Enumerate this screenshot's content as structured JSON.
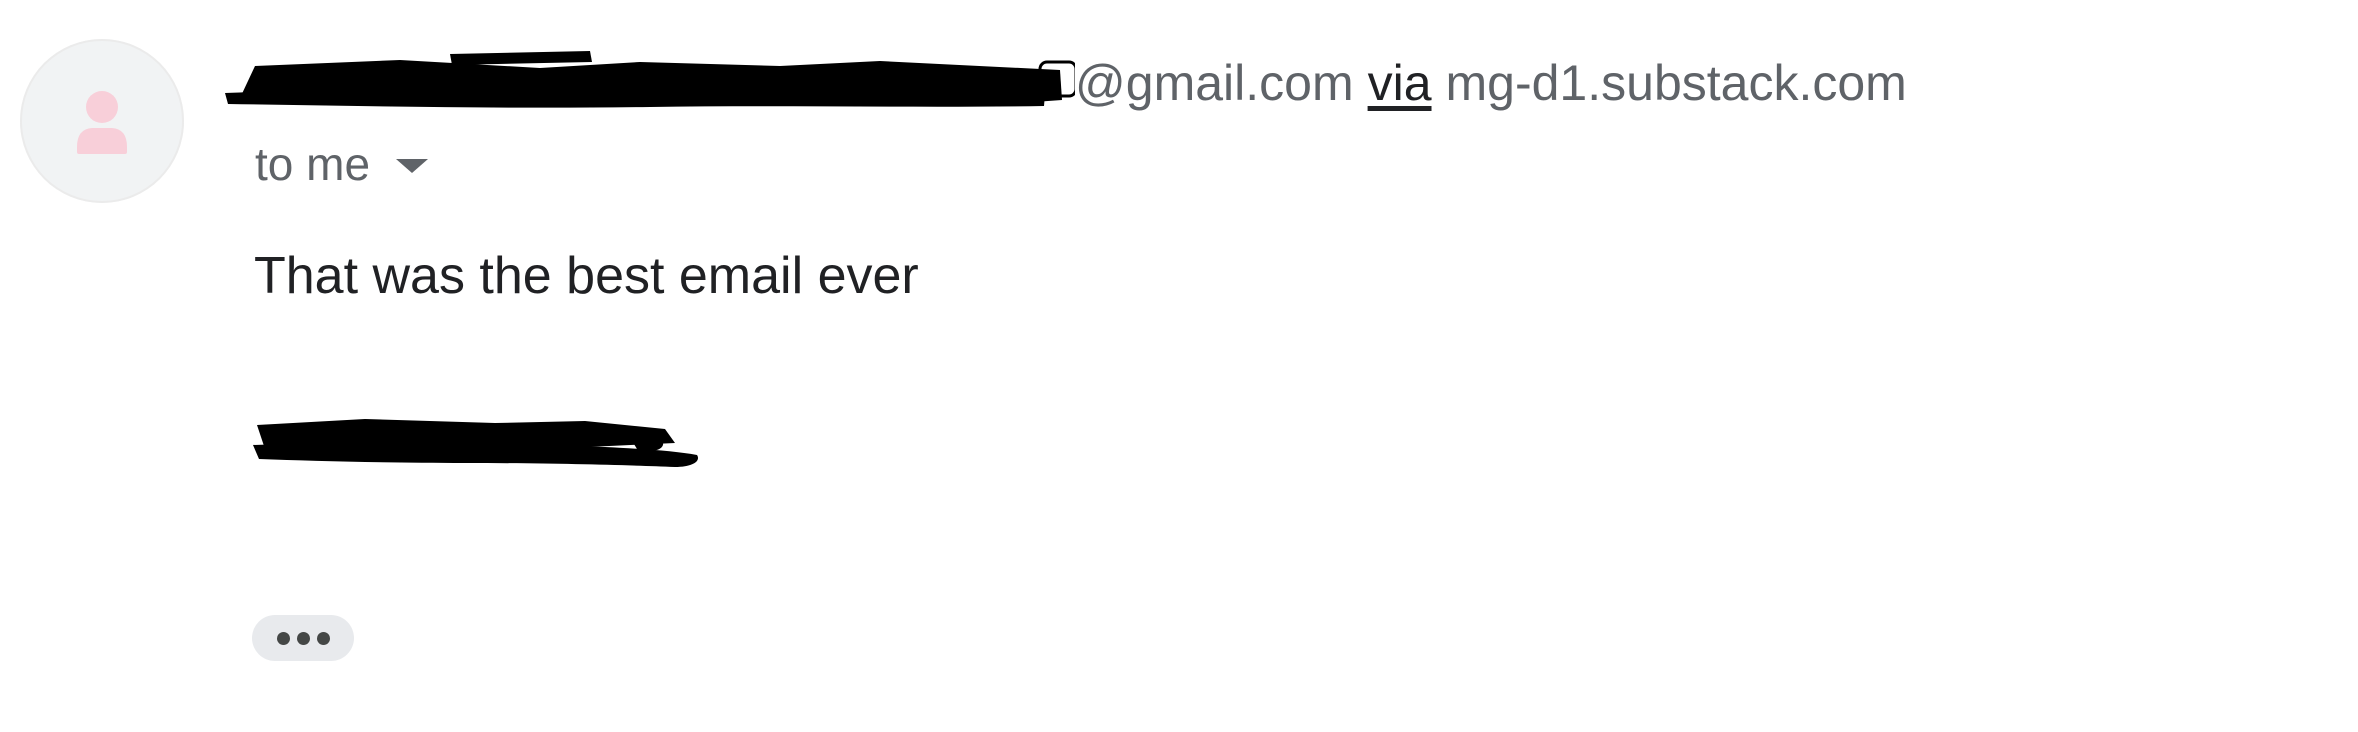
{
  "message": {
    "sender": {
      "email_domain": "@gmail.com",
      "via_label": "via",
      "via_host": "mg-d1.substack.com",
      "avatar_icon": "person-icon",
      "avatar_color": "#f8cfd9"
    },
    "recipient": {
      "label": "to me",
      "dropdown_icon": "caret-down-icon"
    },
    "body": {
      "text": "That was the best email ever"
    },
    "actions": {
      "trimmed_content_icon": "more-horizontal-icon"
    }
  }
}
